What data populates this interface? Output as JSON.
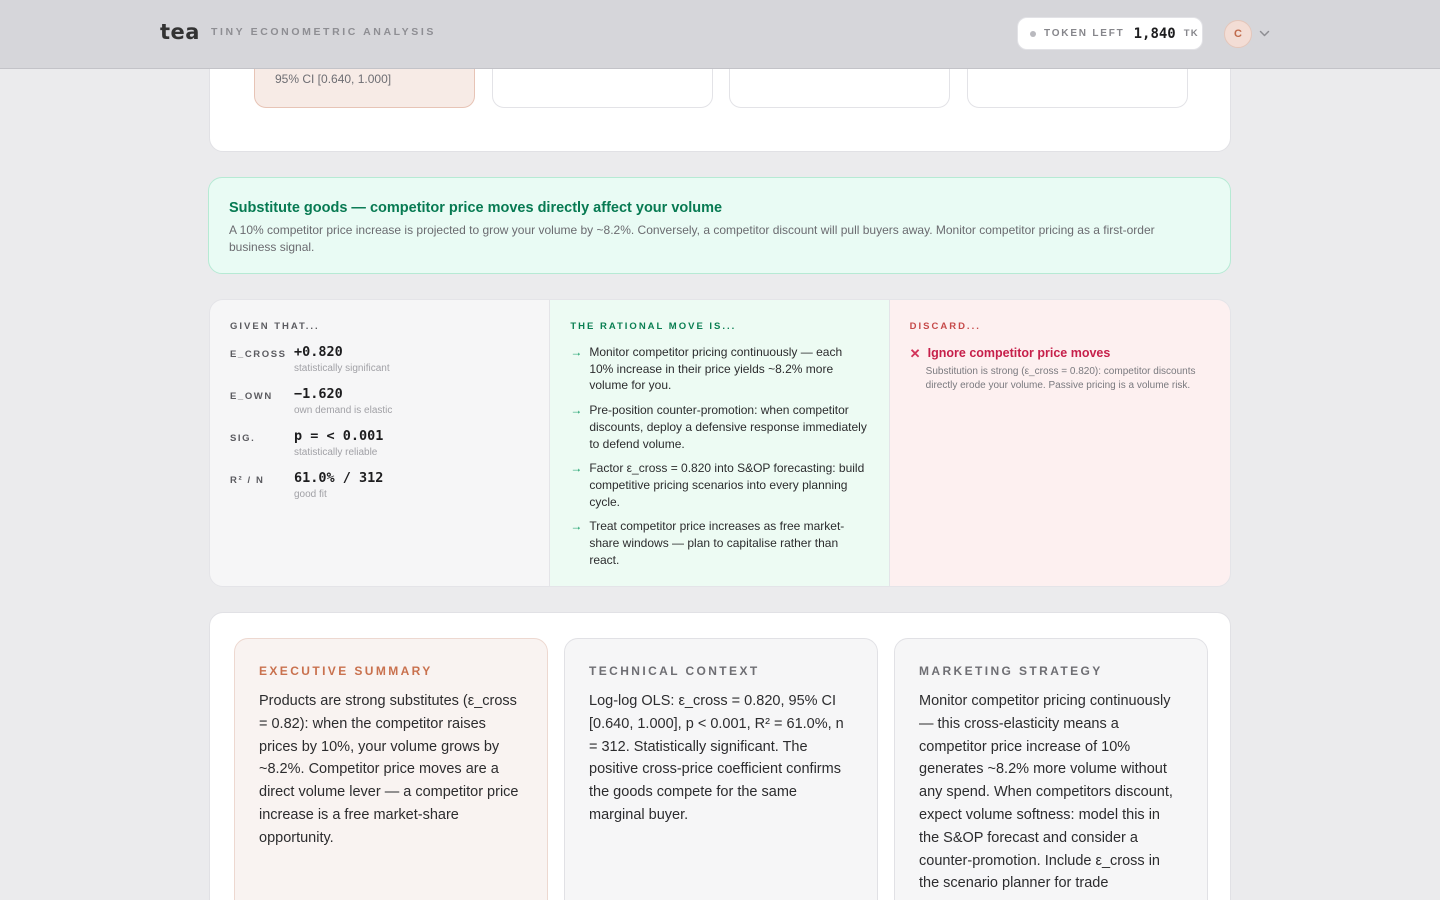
{
  "header": {
    "logo": "tea",
    "tagline": "TINY ECONOMETRIC ANALYSIS",
    "token_label": "TOKEN LEFT",
    "token_value": "1,840",
    "token_unit": "TK",
    "avatar_initial": "C"
  },
  "top_card": {
    "ci_text": "95% CI [0.640, 1.000]"
  },
  "insight": {
    "title": "Substitute goods — competitor price moves directly affect your volume",
    "body": "A 10% competitor price increase is projected to grow your volume by ~8.2%. Conversely, a competitor discount will pull buyers away. Monitor competitor pricing as a first-order business signal."
  },
  "given": {
    "title": "GIVEN THAT...",
    "rows": [
      {
        "label": "E_CROSS",
        "value": "+0.820",
        "sub": "statistically significant"
      },
      {
        "label": "E_OWN",
        "value": "−1.620",
        "sub": "own demand is elastic"
      },
      {
        "label": "SIG.",
        "value": "p = < 0.001",
        "sub": "statistically reliable"
      },
      {
        "label": "R² / N",
        "value": "61.0% / 312",
        "sub": "good fit"
      }
    ]
  },
  "move": {
    "title": "THE RATIONAL MOVE IS...",
    "items": [
      "Monitor competitor pricing continuously — each 10% increase in their price yields ~8.2% more volume for you.",
      "Pre-position counter-promotion: when competitor discounts, deploy a defensive response immediately to defend volume.",
      "Factor ε_cross = 0.820 into S&OP forecasting: build competitive pricing scenarios into every planning cycle.",
      "Treat competitor price increases as free market-share windows — plan to capitalise rather than react."
    ]
  },
  "discard": {
    "title": "DISCARD...",
    "item_title": "Ignore competitor price moves",
    "item_desc": "Substitution is strong (ε_cross = 0.820): competitor discounts directly erode your volume. Passive pricing is a volume risk."
  },
  "panels": {
    "exec": {
      "title": "EXECUTIVE SUMMARY",
      "body": "Products are strong substitutes (ε_cross = 0.82): when the competitor raises prices by 10%, your volume grows by ~8.2%. Competitor price moves are a direct volume lever — a competitor price increase is a free market-share opportunity."
    },
    "tech": {
      "title": "TECHNICAL CONTEXT",
      "body": "Log-log OLS: ε_cross = 0.820, 95% CI [0.640, 1.000], p < 0.001, R² = 61.0%, n = 312. Statistically significant. The positive cross-price coefficient confirms the goods compete for the same marginal buyer."
    },
    "mkt": {
      "title": "MARKETING STRATEGY",
      "body": "Monitor competitor pricing continuously — this cross-elasticity means a competitor price increase of 10% generates ~8.2% more volume without any spend. When competitors discount, expect volume softness: model this in the S&OP forecast and consider a counter-promotion. Include ε_cross in the scenario planner for trade"
    }
  },
  "icons": {
    "arrow": "arrow-right-icon",
    "discard": "x-icon",
    "menu": "chevron-down-icon"
  },
  "colors": {
    "accent_green": "#077a52",
    "accent_red": "#c61f4a",
    "accent_orange": "#c9714e"
  }
}
